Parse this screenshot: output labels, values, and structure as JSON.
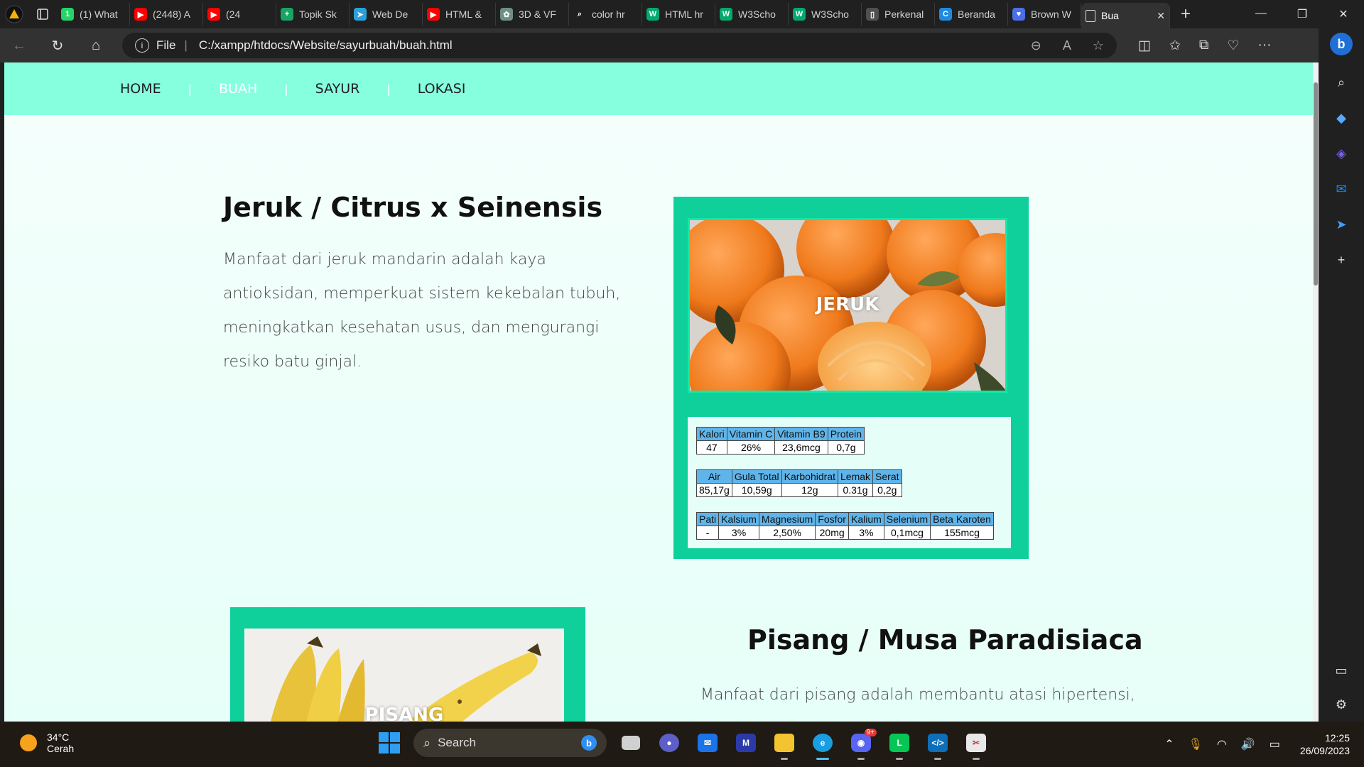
{
  "browser": {
    "tabs": [
      {
        "label": "(1) What",
        "icon": "whatsapp-icon",
        "color": "#25d366",
        "glyph": "1"
      },
      {
        "label": "(2448) A",
        "icon": "youtube-icon",
        "color": "#ff0000",
        "glyph": "▶"
      },
      {
        "label": "(24",
        "icon": "youtube-icon",
        "color": "#ff0000",
        "glyph": "▶"
      },
      {
        "label": "Topik Sk",
        "icon": "sheets-icon",
        "color": "#19a463",
        "glyph": "+"
      },
      {
        "label": "Web De",
        "icon": "telegram-icon",
        "color": "#2aa1da",
        "glyph": "➤"
      },
      {
        "label": "HTML &",
        "icon": "youtube-icon",
        "color": "#ff0000",
        "glyph": "▶"
      },
      {
        "label": "3D & VF",
        "icon": "chatgpt-icon",
        "color": "#6e8f86",
        "glyph": "✿"
      },
      {
        "label": "color hr",
        "icon": "search-icon",
        "color": "#202020",
        "glyph": "⌕"
      },
      {
        "label": "HTML hr",
        "icon": "w3schools-icon",
        "color": "#04aa6d",
        "glyph": "W"
      },
      {
        "label": "W3Scho",
        "icon": "w3schools-icon",
        "color": "#04aa6d",
        "glyph": "W"
      },
      {
        "label": "W3Scho",
        "icon": "w3schools-icon",
        "color": "#04aa6d",
        "glyph": "W"
      },
      {
        "label": "Perkenal",
        "icon": "page-icon",
        "color": "#505050",
        "glyph": "▯"
      },
      {
        "label": "Beranda",
        "icon": "canva-icon",
        "color": "#1f8ae0",
        "glyph": "C"
      },
      {
        "label": "Brown W",
        "icon": "heart-icon",
        "color": "#4b6fe8",
        "glyph": "♥"
      }
    ],
    "active_tab": {
      "label": "Bua",
      "icon": "page-icon"
    },
    "url_prefix": "File",
    "url": "C:/xampp/htdocs/Website/sayurbuah/buah.html"
  },
  "site": {
    "nav": [
      {
        "label": "HOME",
        "current": false
      },
      {
        "label": "BUAH",
        "current": true
      },
      {
        "label": "SAYUR",
        "current": false
      },
      {
        "label": "LOKASI",
        "current": false
      }
    ],
    "nav_divider": "|",
    "jeruk": {
      "title": "Jeruk / Citrus x Seinensis",
      "desc": "Manfaat dari jeruk mandarin adalah kaya antioksidan, memperkuat sistem kekebalan tubuh, meningkatkan kesehatan usus, dan mengurangi resiko batu ginjal.",
      "photo_label": "JERUK",
      "tables": [
        {
          "headers": [
            "Kalori",
            "Vitamin C",
            "Vitamin B9",
            "Protein"
          ],
          "values": [
            "47",
            "26%",
            "23,6mcg",
            "0,7g"
          ]
        },
        {
          "headers": [
            "Air",
            "Gula Total",
            "Karbohidrat",
            "Lemak",
            "Serat"
          ],
          "values": [
            "85,17g",
            "10,59g",
            "12g",
            "0.31g",
            "0,2g"
          ]
        },
        {
          "headers": [
            "Pati",
            "Kalsium",
            "Magnesium",
            "Fosfor",
            "Kalium",
            "Selenium",
            "Beta Karoten"
          ],
          "values": [
            "-",
            "3%",
            "2,50%",
            "20mg",
            "3%",
            "0,1mcg",
            "155mcg"
          ]
        }
      ]
    },
    "pisang": {
      "title": "Pisang / Musa Paradisiaca",
      "desc": "Manfaat dari pisang adalah membantu atasi hipertensi,",
      "photo_label": "PISANG"
    }
  },
  "taskbar": {
    "temperature": "34°C",
    "weather": "Cerah",
    "search_placeholder": "Search",
    "time": "12:25",
    "date": "26/09/2023",
    "discord_badge": "9+"
  },
  "colors": {
    "nav_bg": "#86ffdf",
    "card_bg": "#0fcf9a",
    "table_header": "#5fb4ea"
  }
}
